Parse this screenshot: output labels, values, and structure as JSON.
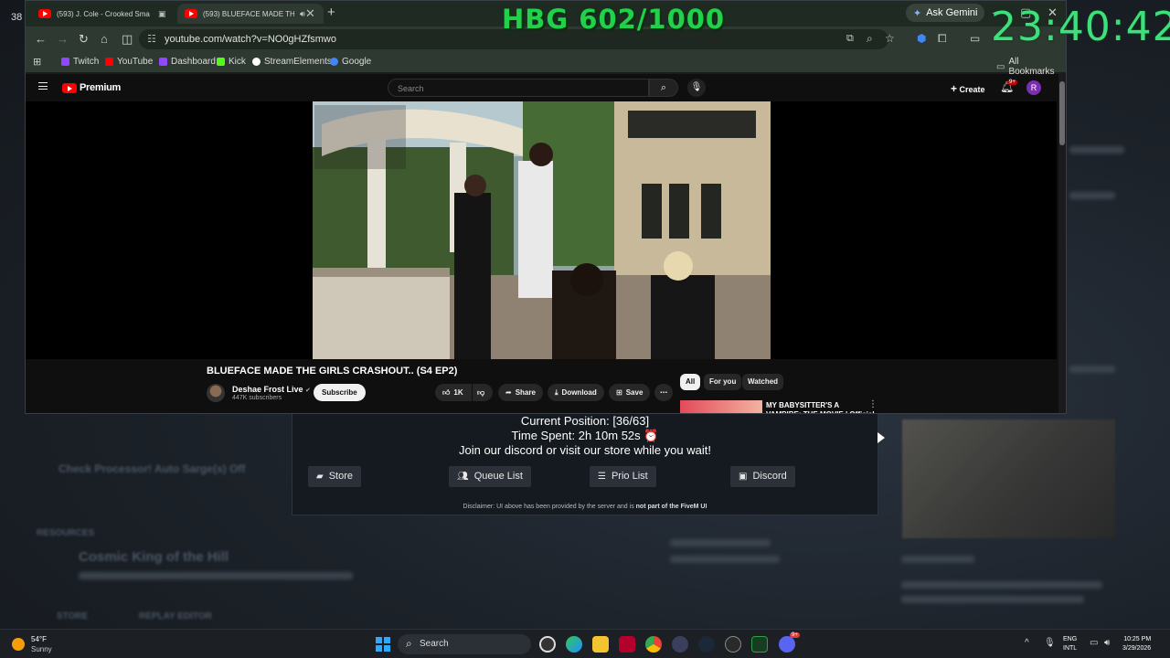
{
  "overlay": {
    "counter": "HBG 602/1000",
    "clock": "23:40:42",
    "corner_text": "38"
  },
  "browser": {
    "tabs": [
      {
        "label": "(593) J. Cole - Crooked Sma",
        "active": false
      },
      {
        "label": "(593) BLUEFACE MADE THE",
        "active": true
      }
    ],
    "ask_gemini": "Ask Gemini",
    "url": "youtube.com/watch?v=NO0gHZfsmwo",
    "bookmarks": [
      {
        "label": "Twitch",
        "color": "#9146ff"
      },
      {
        "label": "YouTube",
        "color": "#ff0000"
      },
      {
        "label": "Dashboard",
        "color": "#9146ff"
      },
      {
        "label": "Kick",
        "color": "#53fc18"
      },
      {
        "label": "StreamElements",
        "color": "#ffffff"
      },
      {
        "label": "Google",
        "color": "#4285f4"
      }
    ],
    "all_bookmarks": "All Bookmarks"
  },
  "youtube": {
    "logo_label": "Premium",
    "search_placeholder": "Search",
    "create_label": "Create",
    "notification_count": "9+",
    "avatar_letter": "R",
    "video_title": "BLUEFACE MADE THE GIRLS CRASHOUT.. (S4 EP2)",
    "channel_name": "Deshae Frost Live",
    "subscribers": "447K subscribers",
    "subscribe_label": "Subscribe",
    "like_count": "1K",
    "share_label": "Share",
    "download_label": "Download",
    "save_label": "Save",
    "chips": [
      {
        "label": "All",
        "selected": true
      },
      {
        "label": "For you",
        "selected": false
      },
      {
        "label": "Watched",
        "selected": false
      }
    ],
    "recommendation_title": "MY BABYSITTER'S A VAMPIRE: THE MOVIE | Official HD"
  },
  "queue": {
    "position": "Current Position: [36/63]",
    "time_spent": "Time Spent: 2h 10m 52s ⏰",
    "join_message": "Join our discord or visit our store while you wait!",
    "buttons": {
      "store": "Store",
      "queue_list": "Queue List",
      "prio_list": "Prio List",
      "discord": "Discord"
    },
    "disclaimer_prefix": "Disclaimer: UI above has been provided by the server and is",
    "disclaimer_bold": "not part of the FiveM UI"
  },
  "background": {
    "server_line": "Check Processor! Auto Sarge(s) Off",
    "section_label": "RESOURCES",
    "server_name": "Cosmic King of the Hill",
    "store_label": "STORE",
    "replay_label": "REPLAY EDITOR"
  },
  "taskbar": {
    "temperature": "54°F",
    "condition": "Sunny",
    "search_label": "Search",
    "language_top": "ENG",
    "language_bottom": "INTL",
    "time": "10:25 PM",
    "date": "3/29/2026",
    "discord_badge": "9+"
  }
}
